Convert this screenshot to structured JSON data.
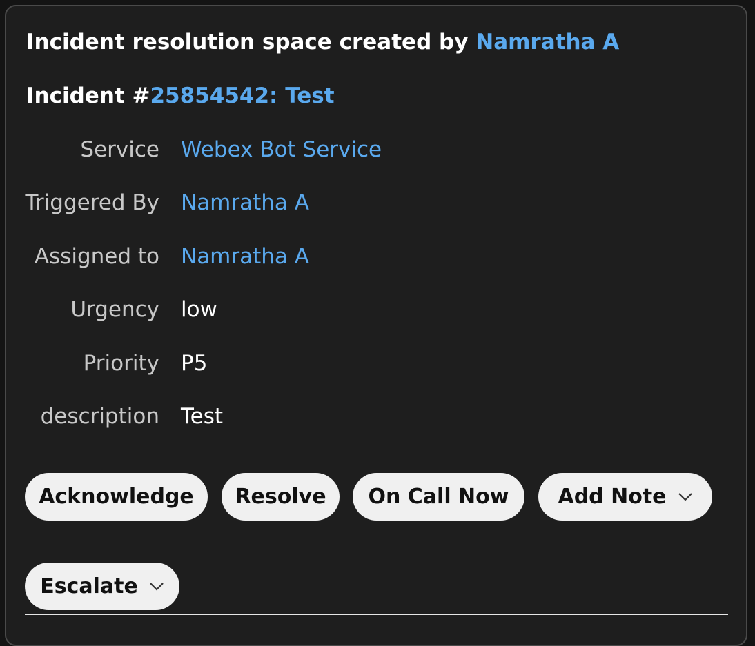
{
  "header": {
    "created_prefix": "Incident resolution space created by ",
    "creator": "Namratha A"
  },
  "incident": {
    "prefix": "Incident #",
    "link_text": "25854542: Test"
  },
  "fields": {
    "service": {
      "label": "Service",
      "value": "Webex Bot Service"
    },
    "triggered_by": {
      "label": "Triggered By",
      "value": "Namratha A"
    },
    "assigned_to": {
      "label": "Assigned to",
      "value": "Namratha A"
    },
    "urgency": {
      "label": "Urgency",
      "value": "low"
    },
    "priority": {
      "label": "Priority",
      "value": "P5"
    },
    "description": {
      "label": "description",
      "value": "Test"
    }
  },
  "actions": {
    "acknowledge": "Acknowledge",
    "resolve": "Resolve",
    "on_call_now": "On Call Now",
    "add_note": "Add Note",
    "escalate": "Escalate"
  },
  "colors": {
    "link": "#5aa9ee",
    "card_background": "#1e1e1e",
    "button_background": "#f0f0f0"
  }
}
